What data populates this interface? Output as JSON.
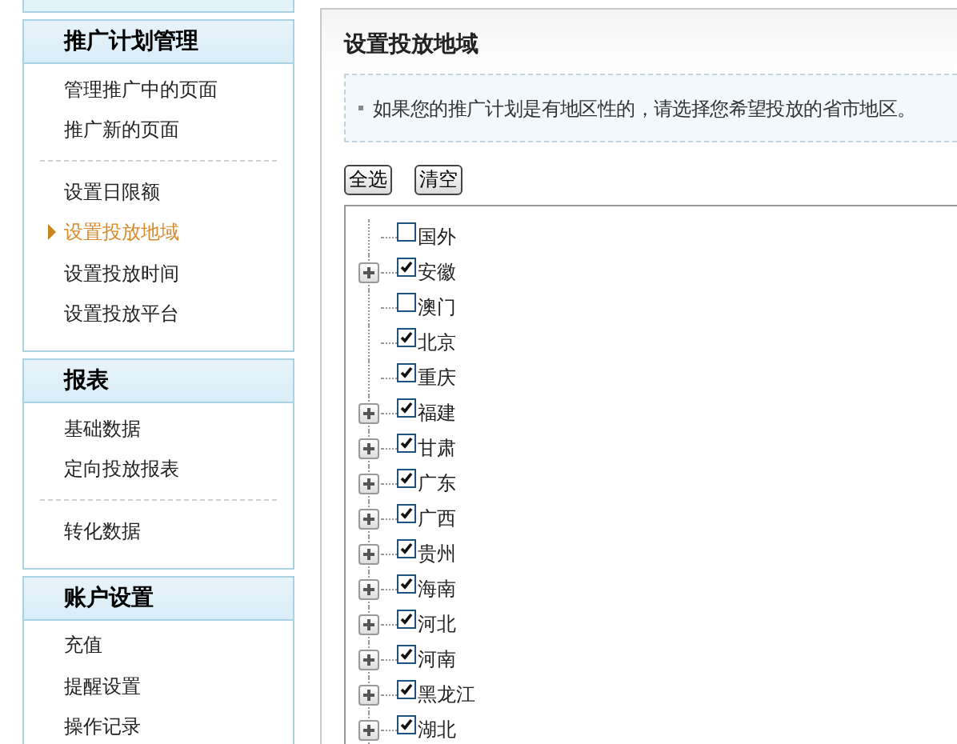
{
  "sidebar": {
    "sections": [
      {
        "title": "推广计划管理",
        "groups": [
          [
            {
              "label": "管理推广中的页面",
              "selected": false
            },
            {
              "label": "推广新的页面",
              "selected": false
            }
          ],
          [
            {
              "label": "设置日限额",
              "selected": false
            },
            {
              "label": "设置投放地域",
              "selected": true
            },
            {
              "label": "设置投放时间",
              "selected": false
            },
            {
              "label": "设置投放平台",
              "selected": false
            }
          ]
        ]
      },
      {
        "title": "报表",
        "groups": [
          [
            {
              "label": "基础数据",
              "selected": false
            },
            {
              "label": "定向投放报表",
              "selected": false
            }
          ],
          [
            {
              "label": "转化数据",
              "selected": false
            }
          ]
        ]
      },
      {
        "title": "账户设置",
        "groups": [
          [
            {
              "label": "充值",
              "selected": false
            },
            {
              "label": "提醒设置",
              "selected": false
            },
            {
              "label": "操作记录",
              "selected": false
            }
          ]
        ]
      }
    ]
  },
  "main": {
    "title": "设置投放地域",
    "notice": "如果您的推广计划是有地区性的，请选择您希望投放的省市地区。",
    "buttons": [
      "全选",
      "清空"
    ],
    "regions": [
      {
        "label": "国外",
        "checked": false,
        "expandable": false
      },
      {
        "label": "安徽",
        "checked": true,
        "expandable": true
      },
      {
        "label": "澳门",
        "checked": false,
        "expandable": false
      },
      {
        "label": "北京",
        "checked": true,
        "expandable": false
      },
      {
        "label": "重庆",
        "checked": true,
        "expandable": false
      },
      {
        "label": "福建",
        "checked": true,
        "expandable": true
      },
      {
        "label": "甘肃",
        "checked": true,
        "expandable": true
      },
      {
        "label": "广东",
        "checked": true,
        "expandable": true
      },
      {
        "label": "广西",
        "checked": true,
        "expandable": true
      },
      {
        "label": "贵州",
        "checked": true,
        "expandable": true
      },
      {
        "label": "海南",
        "checked": true,
        "expandable": true
      },
      {
        "label": "河北",
        "checked": true,
        "expandable": true
      },
      {
        "label": "河南",
        "checked": true,
        "expandable": true
      },
      {
        "label": "黑龙江",
        "checked": true,
        "expandable": true
      },
      {
        "label": "湖北",
        "checked": true,
        "expandable": true
      }
    ]
  }
}
